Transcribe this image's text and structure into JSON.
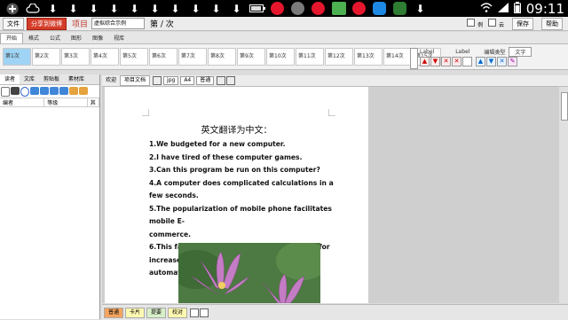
{
  "status_bar": {
    "icons": [
      "add-icon",
      "cloud-icon",
      "download-icon",
      "download-icon",
      "download-icon",
      "download-icon",
      "download-icon",
      "download-icon",
      "download-icon",
      "download-icon",
      "download-icon",
      "download-icon",
      "battery-icon",
      "weibo-icon",
      "cloud-weather-icon",
      "weibo-icon",
      "hao123-icon",
      "weibo-icon",
      "app-icon",
      "pp-icon",
      "download-icon",
      "wifi-icon",
      "signal-icon",
      "battery-icon"
    ],
    "time": "09:11"
  },
  "toolbar": {
    "file_button": "文件",
    "share_button": "分享到微博",
    "project_label": "项目",
    "project_select": "虚拟综合示例",
    "page_text": "第 / 次",
    "check_label_1": "例",
    "check_label_2": "云",
    "save_button": "保存",
    "help_button": "帮助"
  },
  "ribbon_tabs": [
    "开始",
    "格式",
    "公式",
    "图形",
    "图像",
    "视库"
  ],
  "rounds": [
    "第1次",
    "第2次",
    "第3次",
    "第4次",
    "第5次",
    "第6次",
    "第7次",
    "第8次",
    "第9次",
    "第10次",
    "第11次",
    "第12次",
    "第13次",
    "第14次",
    "第15次"
  ],
  "ribbon_right": {
    "label1": "Label",
    "label2": "Label",
    "edit_type": "编辑类型",
    "edit_type_value": "文字"
  },
  "left_panel": {
    "tabs": [
      "读者",
      "文库",
      "剪贴板",
      "素材库"
    ],
    "columns": [
      "编者",
      "等级",
      "其"
    ]
  },
  "doc_header": {
    "tabs": [
      "欢迎",
      "项目文档"
    ],
    "format": "jpg",
    "paper": "A4",
    "mode": "普通"
  },
  "document": {
    "title": "英文翻译为中文：",
    "items": [
      "1.We budgeted for a new computer.",
      "2.I have tired of these computer games.",
      "3.Can this program be run on this computer?",
      "4.A computer does complicated calculations in a few seconds.",
      "5.The popularization of mobile phone facilitates mobile E-",
      "commerce.",
      "6.This factory has phased in new machinery for increased",
      "automation."
    ]
  },
  "bottom_tabs": [
    "普通",
    "卡片",
    "提要",
    "校对"
  ],
  "colors": {
    "accent_blue": "#9fd4f5",
    "share_red": "#d43d2a",
    "project_red": "#c0392b"
  }
}
